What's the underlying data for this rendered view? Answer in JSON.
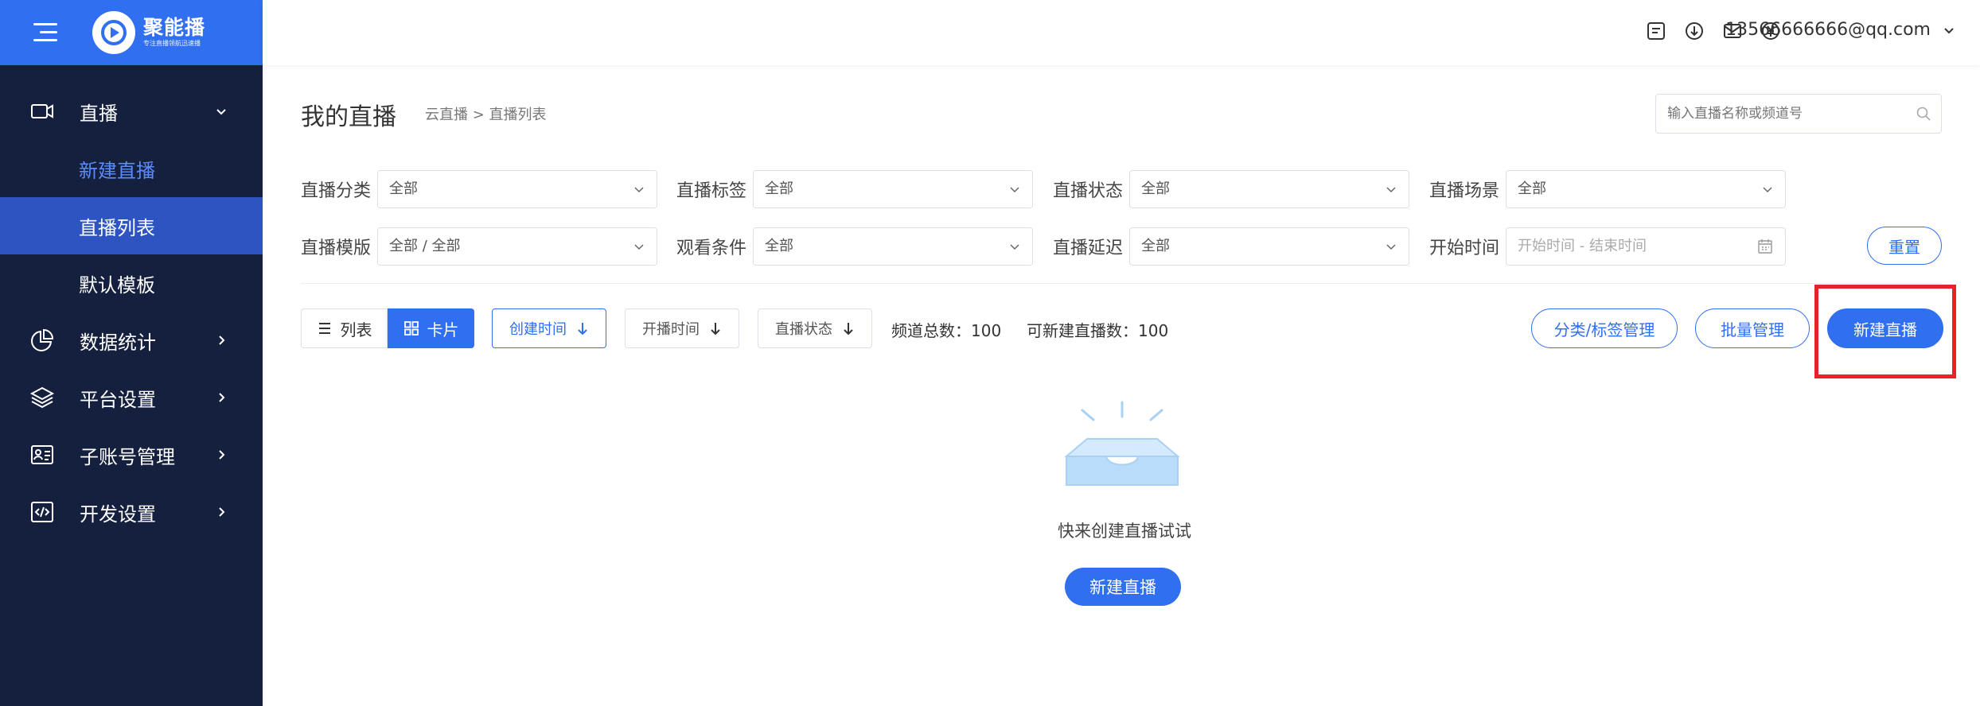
{
  "brand": {
    "name": "聚能播",
    "slogan": "专注直播领航迅速播"
  },
  "sidebar": {
    "live": {
      "label": "直播"
    },
    "sub_items": [
      {
        "label": "新建直播"
      },
      {
        "label": "直播列表"
      },
      {
        "label": "默认模板"
      }
    ],
    "items": [
      {
        "label": "数据统计"
      },
      {
        "label": "平台设置"
      },
      {
        "label": "子账号管理"
      },
      {
        "label": "开发设置"
      }
    ]
  },
  "topbar": {
    "user_email": "13566666666@qq.com"
  },
  "header": {
    "title": "我的直播",
    "breadcrumb": "云直播 >  直播列表",
    "search_placeholder": "输入直播名称或频道号"
  },
  "filters": {
    "category": {
      "label": "直播分类",
      "value": "全部"
    },
    "tag": {
      "label": "直播标签",
      "value": "全部"
    },
    "status": {
      "label": "直播状态",
      "value": "全部"
    },
    "scene": {
      "label": "直播场景",
      "value": "全部"
    },
    "template": {
      "label": "直播模版",
      "value": "全部 / 全部"
    },
    "condition": {
      "label": "观看条件",
      "value": "全部"
    },
    "latency": {
      "label": "直播延迟",
      "value": "全部"
    },
    "start_time": {
      "label": "开始时间",
      "placeholder": "开始时间 - 结束时间"
    },
    "reset_label": "重置"
  },
  "toolbar": {
    "list_label": "列表",
    "card_label": "卡片",
    "sort_created": "创建时间",
    "sort_start": "开播时间",
    "sort_status": "直播状态",
    "channel_total": "频道总数：100",
    "can_create": "可新建直播数：100",
    "category_manage": "分类/标签管理",
    "batch_manage": "批量管理",
    "create_live": "新建直播"
  },
  "empty": {
    "text": "快来创建直播试试",
    "button": "新建直播"
  },
  "colors": {
    "primary": "#2f6ff0",
    "sidebar_bg": "#15203f",
    "highlight": "#e8222a"
  }
}
